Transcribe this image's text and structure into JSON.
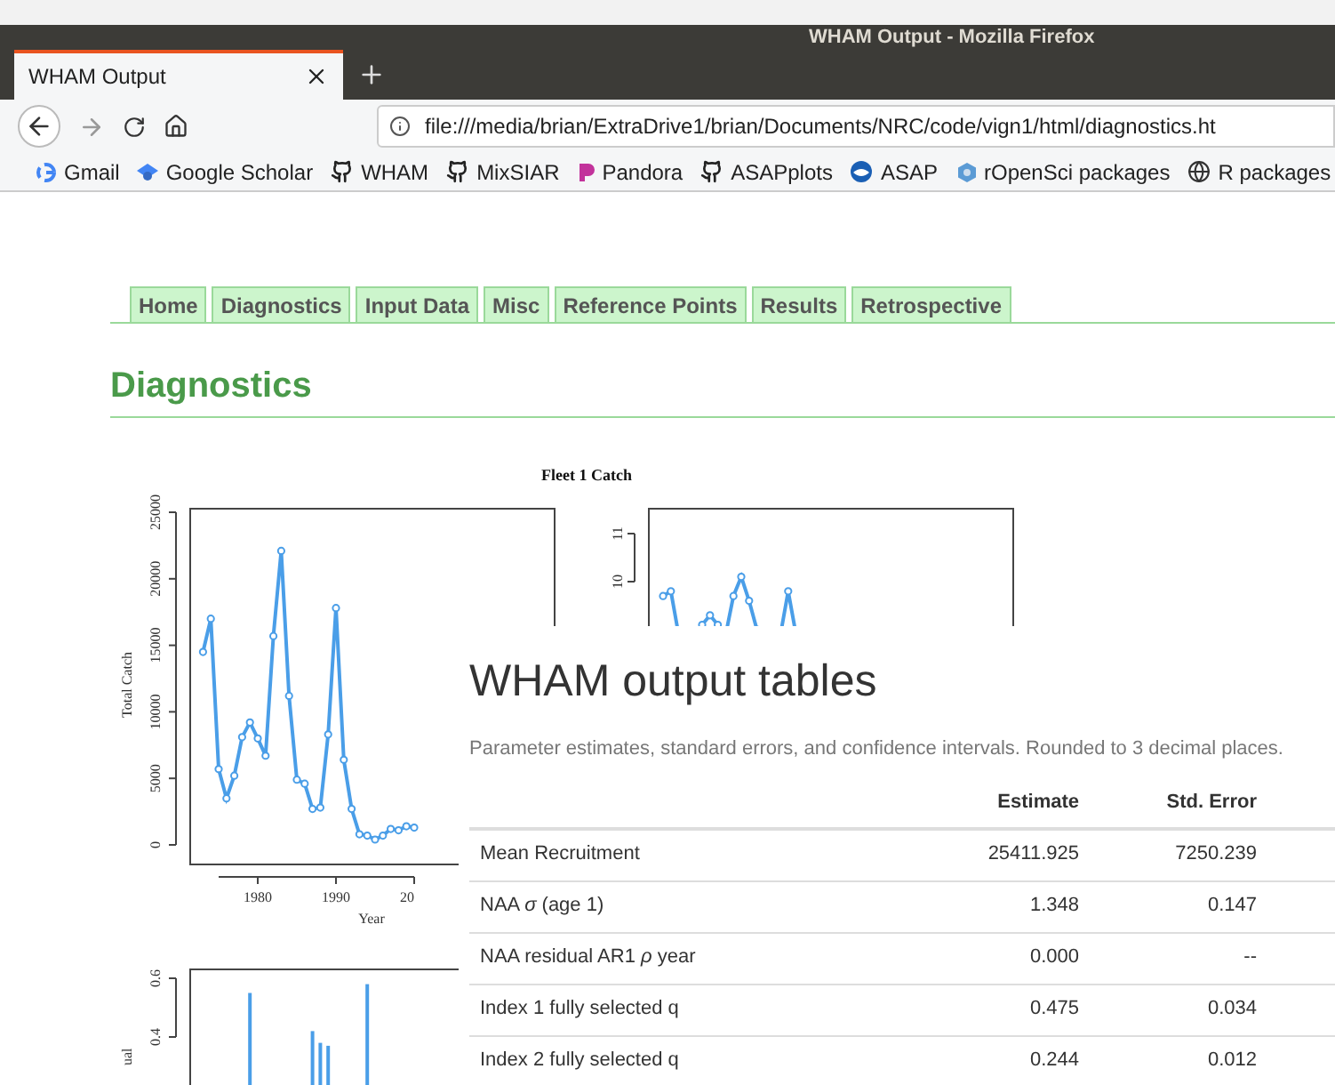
{
  "window": {
    "title": "WHAM Output - Mozilla Firefox"
  },
  "tabs": [
    {
      "label": "WHAM Output",
      "selected": true
    }
  ],
  "address_bar": {
    "url": "file:///media/brian/ExtraDrive1/brian/Documents/NRC/code/vign1/html/diagnostics.ht"
  },
  "bookmarks": [
    {
      "label": "Gmail",
      "kind": "google"
    },
    {
      "label": "Google Scholar",
      "kind": "scholar"
    },
    {
      "label": "WHAM",
      "kind": "github"
    },
    {
      "label": "MixSIAR",
      "kind": "github"
    },
    {
      "label": "Pandora",
      "kind": "pandora"
    },
    {
      "label": "ASAPplots",
      "kind": "github"
    },
    {
      "label": "ASAP",
      "kind": "noaa"
    },
    {
      "label": "rOpenSci packages",
      "kind": "ropensci"
    },
    {
      "label": "R packages",
      "kind": "globe"
    }
  ],
  "page": {
    "nav": [
      "Home",
      "Diagnostics",
      "Input Data",
      "Misc",
      "Reference Points",
      "Results",
      "Retrospective"
    ],
    "heading": "Diagnostics",
    "figure_title": "Fleet 1 Catch",
    "plots": [
      {
        "kind": "line",
        "ylabel": "Total Catch",
        "xlabel": "Year",
        "y_tick_labels": [
          "0",
          "5000",
          "10000",
          "15000",
          "20000",
          "25000"
        ],
        "x_tick_labels": [
          "1980",
          "1990",
          "20"
        ]
      },
      {
        "kind": "line",
        "y_tick_labels": [
          "10",
          "11"
        ]
      },
      {
        "kind": "bars",
        "ylabel": "ual",
        "y_tick_labels": [
          "0.4",
          "0.6"
        ]
      }
    ]
  },
  "overlay": {
    "title": "WHAM output tables",
    "caption": "Parameter estimates, standard errors, and confidence intervals. Rounded to 3 decimal places.",
    "columns": [
      "Estimate",
      "Std. Error"
    ],
    "rows": [
      {
        "parameter": "Mean Recruitment",
        "estimate": "25411.925",
        "std_error": "7250.239"
      },
      {
        "parameter": "NAA *σ* (age 1)",
        "estimate": "1.348",
        "std_error": "0.147"
      },
      {
        "parameter": "NAA residual AR1 *ρ* year",
        "estimate": "0.000",
        "std_error": "--"
      },
      {
        "parameter": "Index 1 fully selected q",
        "estimate": "0.475",
        "std_error": "0.034"
      },
      {
        "parameter": "Index 2 fully selected q",
        "estimate": "0.244",
        "std_error": "0.012"
      }
    ]
  }
}
